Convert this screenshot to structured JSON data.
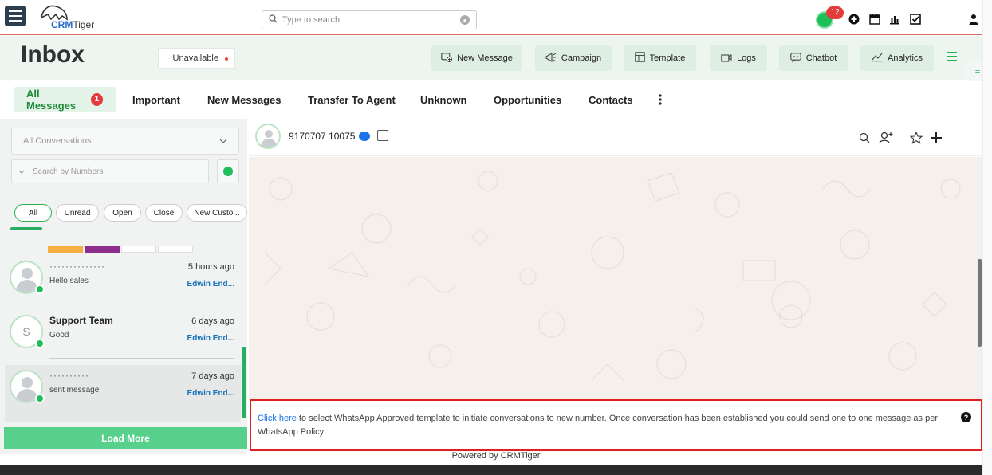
{
  "topbar": {
    "logo_text_crm": "CRM",
    "logo_text_tiger": "Tiger",
    "search_placeholder": "Type to search",
    "notification_count": "12",
    "icons": [
      "plus-circle-icon",
      "calendar-icon",
      "chart-icon",
      "checkbox-icon",
      "user-icon"
    ]
  },
  "header": {
    "title": "Inbox",
    "status": "Unavailable",
    "buttons": [
      {
        "label": "New Message",
        "icon": "new-message-icon"
      },
      {
        "label": "Campaign",
        "icon": "campaign-icon"
      },
      {
        "label": "Template",
        "icon": "template-icon"
      },
      {
        "label": "Logs",
        "icon": "logs-icon"
      },
      {
        "label": "Chatbot",
        "icon": "chatbot-icon"
      },
      {
        "label": "Analytics",
        "icon": "analytics-icon"
      }
    ]
  },
  "tabs": {
    "all_label": "All Messages",
    "all_badge": "1",
    "items": [
      "Important",
      "New Messages",
      "Transfer To Agent",
      "Unknown",
      "Opportunities",
      "Contacts"
    ]
  },
  "sidebar": {
    "conversation_filter": "All Conversations",
    "number_search_placeholder": "Search by Numbers",
    "pills": [
      "All",
      "Unread",
      "Open",
      "Close",
      "New Custo..."
    ],
    "conversations": [
      {
        "name": "··············",
        "message": "Hello sales",
        "time": "5 hours ago",
        "agent": "Edwin End...",
        "avatar_letter": ""
      },
      {
        "name": "Support Team",
        "message": "Good",
        "time": "6 days ago",
        "agent": "Edwin End...",
        "avatar_letter": "S"
      },
      {
        "name": "··········",
        "message": "sent message",
        "time": "7 days ago",
        "agent": "Edwin End...",
        "avatar_letter": ""
      }
    ],
    "load_more": "Load More"
  },
  "chat": {
    "contact_number": "9170707 10075",
    "policy_link": "Click here",
    "policy_text": " to select WhatsApp Approved template to initiate conversations to new number. Once conversation has been established you could send one to one message as per WhatsApp Policy.",
    "help_glyph": "?"
  },
  "footer": {
    "text": "Powered by CRMTiger"
  },
  "colors": {
    "accent_green": "#2bb24c",
    "header_bg": "#ecf6ee",
    "link_blue": "#1a73e8",
    "alert_red": "#e02020",
    "load_more_bg": "#56d08b"
  }
}
